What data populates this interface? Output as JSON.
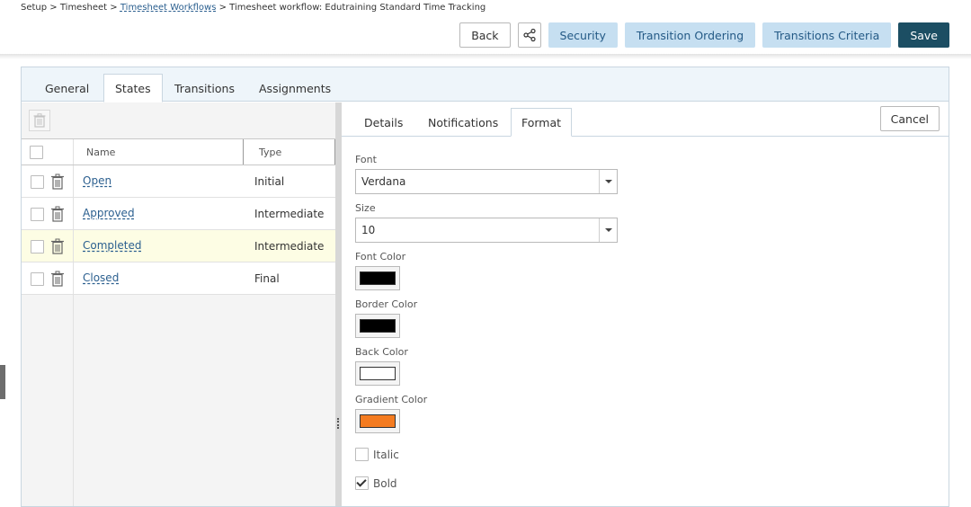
{
  "breadcrumb": {
    "setup": "Setup",
    "sep1": " > ",
    "timesheet": "Timesheet",
    "sep2": " > ",
    "workflows": "Timesheet Workflows",
    "sep3": " > ",
    "current": "Timesheet workflow: Edutraining Standard Time Tracking"
  },
  "toolbar": {
    "back": "Back",
    "share_icon": "share-icon",
    "security": "Security",
    "transition_ordering": "Transition Ordering",
    "transitions_criteria": "Transitions Criteria",
    "save": "Save"
  },
  "tabs": [
    {
      "label": "General",
      "active": false
    },
    {
      "label": "States",
      "active": true
    },
    {
      "label": "Transitions",
      "active": false
    },
    {
      "label": "Assignments",
      "active": false
    }
  ],
  "grid": {
    "columns": {
      "name": "Name",
      "type": "Type"
    },
    "rows": [
      {
        "name": "Open",
        "type": "Initial",
        "selected": false
      },
      {
        "name": "Approved",
        "type": "Intermediate",
        "selected": false
      },
      {
        "name": "Completed",
        "type": "Intermediate",
        "selected": true
      },
      {
        "name": "Closed",
        "type": "Final",
        "selected": false
      }
    ]
  },
  "subtabs": [
    {
      "label": "Details",
      "active": false
    },
    {
      "label": "Notifications",
      "active": false
    },
    {
      "label": "Format",
      "active": true
    }
  ],
  "cancel": "Cancel",
  "format": {
    "font_label": "Font",
    "font_value": "Verdana",
    "size_label": "Size",
    "size_value": "10",
    "font_color_label": "Font Color",
    "font_color": "#000000",
    "border_color_label": "Border Color",
    "border_color": "#000000",
    "back_color_label": "Back Color",
    "back_color": "#ffffff",
    "gradient_color_label": "Gradient Color",
    "gradient_color": "#f47b20",
    "italic_label": "Italic",
    "italic_checked": false,
    "bold_label": "Bold",
    "bold_checked": true
  },
  "colors": {
    "accent_blue": "#c6dff1",
    "save_dark": "#1c4e63",
    "link": "#2b5f8f",
    "selected_row": "#fdfde4"
  }
}
